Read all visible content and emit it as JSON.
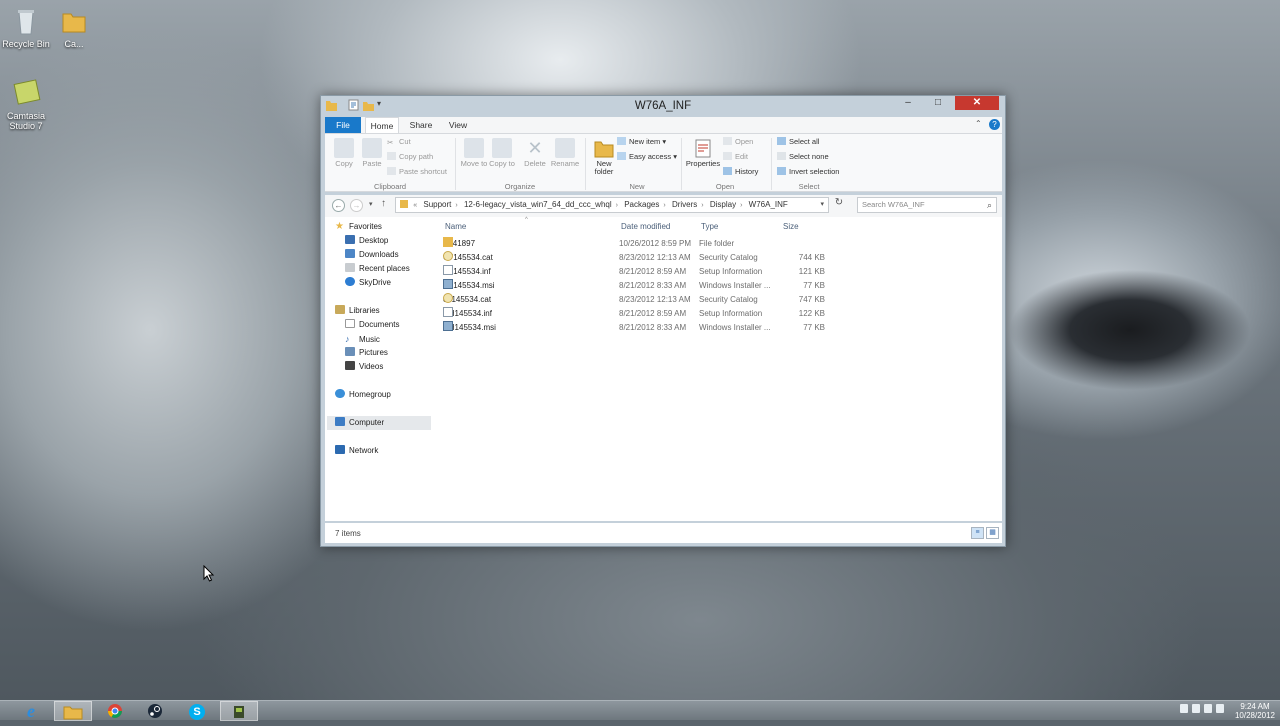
{
  "desktop": {
    "icons": [
      {
        "label": "Recycle Bin"
      },
      {
        "label": "Ca..."
      },
      {
        "label": "Camtasia Studio 7"
      }
    ]
  },
  "window": {
    "title": "W76A_INF",
    "buttons": {
      "minimize": "–",
      "maximize": "□",
      "close": "✕"
    }
  },
  "ribbon": {
    "tabs": [
      "File",
      "Home",
      "Share",
      "View"
    ],
    "clipboard": {
      "copy": "Copy",
      "paste": "Paste",
      "cut": "Cut",
      "copy_path": "Copy path",
      "paste_shortcut": "Paste shortcut",
      "label": "Clipboard"
    },
    "organize": {
      "move_to": "Move to",
      "copy_to": "Copy to",
      "delete": "Delete",
      "rename": "Rename",
      "label": "Organize"
    },
    "new": {
      "new_folder": "New folder",
      "new_item": "New item",
      "easy_access": "Easy access",
      "label": "New"
    },
    "open": {
      "properties": "Properties",
      "open": "Open",
      "edit": "Edit",
      "history": "History",
      "label": "Open"
    },
    "select": {
      "select_all": "Select all",
      "select_none": "Select none",
      "invert_selection": "Invert selection",
      "label": "Select"
    }
  },
  "address": {
    "crumbs": [
      "«",
      "Support",
      "12-6-legacy_vista_win7_64_dd_ccc_whql",
      "Packages",
      "Drivers",
      "Display",
      "W76A_INF"
    ],
    "search_placeholder": "Search W76A_INF"
  },
  "navpane": {
    "favorites": "Favorites",
    "fav_items": [
      "Desktop",
      "Downloads",
      "Recent places",
      "SkyDrive"
    ],
    "libraries": "Libraries",
    "lib_items": [
      "Documents",
      "Music",
      "Pictures",
      "Videos"
    ],
    "homegroup": "Homegroup",
    "computer": "Computer",
    "network": "Network"
  },
  "columns": {
    "name": "Name",
    "date": "Date modified",
    "type": "Type",
    "size": "Size"
  },
  "files": [
    {
      "name": "B141897",
      "date": "10/26/2012 8:59 PM",
      "type": "File folder",
      "size": "",
      "icon": "folder-icon"
    },
    {
      "name": "C7145534.cat",
      "date": "8/23/2012 12:13 AM",
      "type": "Security Catalog",
      "size": "744 KB",
      "icon": "catalog-icon"
    },
    {
      "name": "C7145534.inf",
      "date": "8/21/2012 8:59 AM",
      "type": "Setup Information",
      "size": "121 KB",
      "icon": "inf-icon"
    },
    {
      "name": "C7145534.msi",
      "date": "8/21/2012 8:33 AM",
      "type": "Windows Installer ...",
      "size": "77 KB",
      "icon": "msi-icon"
    },
    {
      "name": "ch145534.cat",
      "date": "8/23/2012 12:13 AM",
      "type": "Security Catalog",
      "size": "747 KB",
      "icon": "catalog-icon"
    },
    {
      "name": "CH145534.inf",
      "date": "8/21/2012 8:59 AM",
      "type": "Setup Information",
      "size": "122 KB",
      "icon": "inf-icon"
    },
    {
      "name": "CH145534.msi",
      "date": "8/21/2012 8:33 AM",
      "type": "Windows Installer ...",
      "size": "77 KB",
      "icon": "msi-icon"
    }
  ],
  "status": {
    "count": "7 items"
  },
  "taskbar": {
    "apps": [
      "internet-explorer-icon",
      "file-explorer-icon",
      "chrome-icon",
      "steam-icon",
      "skype-icon",
      "camtasia-icon"
    ],
    "skype_glyph": "S",
    "ie_glyph": "e",
    "clock_time": "9:24 AM",
    "clock_date": "10/28/2012"
  },
  "colors": {
    "accent": "#1979ca",
    "close": "#c7382f",
    "folder": "#e8b84a"
  }
}
